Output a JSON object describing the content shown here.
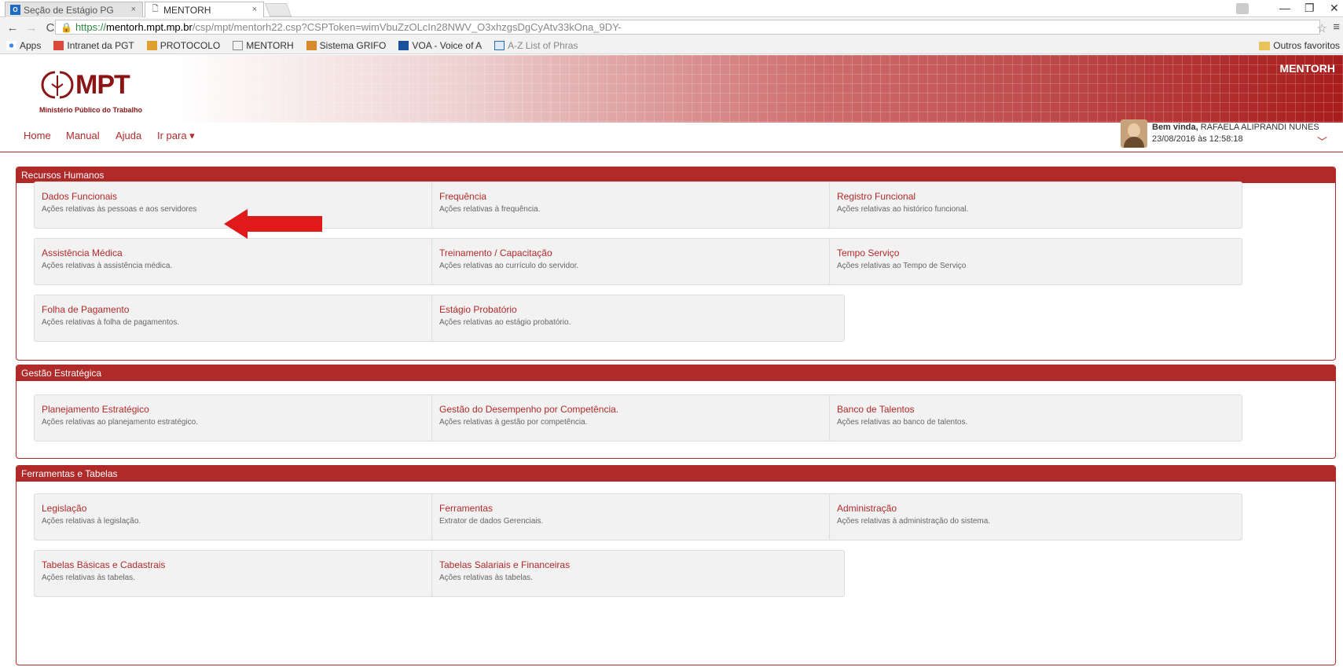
{
  "browser": {
    "tabs": [
      {
        "title": "Seção de Estágio PG",
        "favicon": "outlook-icon"
      },
      {
        "title": "MENTORH",
        "favicon": "page-icon"
      }
    ],
    "url_secure": "https://",
    "url_host": "mentorh.mpt.mp.br",
    "url_path": "/csp/mpt/mentorh22.csp?CSPToken=wimVbuZzOLcIn28NWV_O3xhzgsDgCyAtv33kOna_9DY-",
    "bookmarks": [
      "Apps",
      "Intranet da PGT",
      "PROTOCOLO",
      "MENTORH",
      "Sistema GRIFO",
      "VOA - Voice of A",
      "A-Z List of Phras"
    ],
    "other_bookmarks": "Outros favoritos"
  },
  "header": {
    "logo_text": "MPT",
    "logo_subtitle": "Ministério Público do Trabalho",
    "app_name": "MENTORH"
  },
  "nav": {
    "home": "Home",
    "manual": "Manual",
    "help": "Ajuda",
    "goto": "Ir para ▾"
  },
  "user": {
    "greeting": "Bem vinda,",
    "name": "RAFAELA ALIPRANDI NUNES",
    "datetime": "23/08/2016 às 12:58:18"
  },
  "sections": [
    {
      "title": "Recursos Humanos",
      "cards": [
        {
          "title": "Dados Funcionais",
          "desc": "Ações relativas às pessoas e aos servidores"
        },
        {
          "title": "Frequência",
          "desc": "Ações relativas à frequência."
        },
        {
          "title": "Registro Funcional",
          "desc": "Ações relativas ao histórico funcional."
        },
        {
          "title": "Assistência Médica",
          "desc": "Ações relativas à assistência médica."
        },
        {
          "title": "Treinamento / Capacitação",
          "desc": "Ações relativas ao currículo do servidor."
        },
        {
          "title": "Tempo Serviço",
          "desc": "Ações relativas ao Tempo de Serviço"
        },
        {
          "title": "Folha de Pagamento",
          "desc": "Ações relativas à folha de pagamentos."
        },
        {
          "title": "Estágio Probatório",
          "desc": "Ações relativas ao estágio probatório."
        }
      ]
    },
    {
      "title": "Gestão Estratégica",
      "cards": [
        {
          "title": "Planejamento Estratégico",
          "desc": "Ações relativas ao planejamento estratégico."
        },
        {
          "title": "Gestão do Desempenho por Competência.",
          "desc": "Ações relativas à gestão por competência."
        },
        {
          "title": "Banco de Talentos",
          "desc": "Ações relativas ao banco de talentos."
        }
      ]
    },
    {
      "title": "Ferramentas e Tabelas",
      "cards": [
        {
          "title": "Legislação",
          "desc": "Ações relativas à legislação."
        },
        {
          "title": "Ferramentas",
          "desc": "Extrator de dados Gerenciais."
        },
        {
          "title": "Administração",
          "desc": "Ações relativas à administração do sistema."
        },
        {
          "title": "Tabelas Básicas e Cadastrais",
          "desc": "Ações relativas às tabelas."
        },
        {
          "title": "Tabelas Salariais e Financeiras",
          "desc": "Ações relativas às tabelas."
        }
      ]
    }
  ],
  "colors": {
    "accent": "#b12a2a",
    "arrow": "#e0191b"
  }
}
